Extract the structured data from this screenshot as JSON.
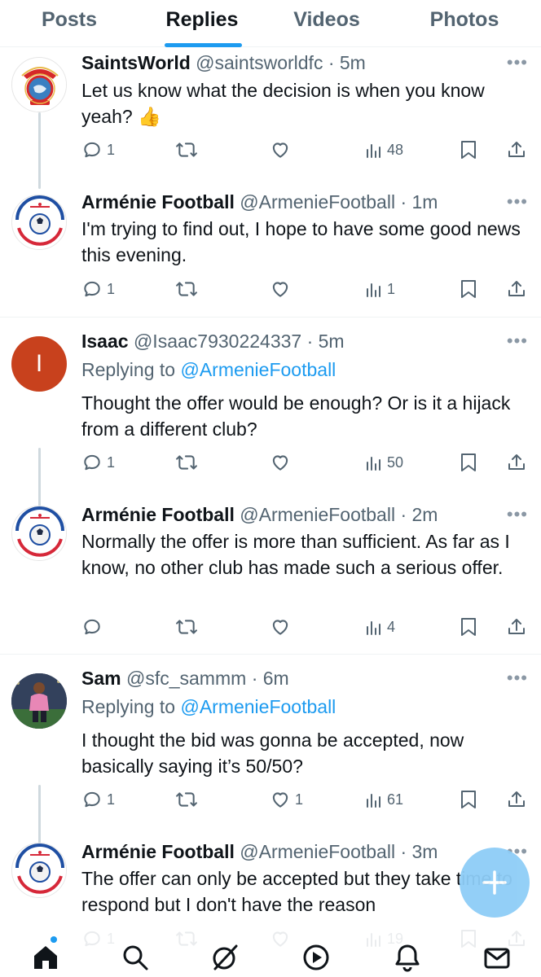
{
  "tabs": [
    {
      "label": "Posts",
      "active": false
    },
    {
      "label": "Replies",
      "active": true
    },
    {
      "label": "Videos",
      "active": false
    },
    {
      "label": "Photos",
      "active": false
    }
  ],
  "tweets": [
    {
      "name": "SaintsWorld",
      "handle": "@saintsworldfc",
      "time": "· 5m",
      "replying_prefix": "",
      "replying_to": "",
      "text": "Let us know what the decision is when you know yeah? 👍",
      "replies": "1",
      "reposts": "",
      "likes": "",
      "views": "48"
    },
    {
      "name": "Arménie Football",
      "handle": "@ArmenieFootball",
      "time": "· 1m",
      "replying_prefix": "",
      "replying_to": "",
      "text": "I'm trying to find out, I hope to have some good news this evening.",
      "replies": "1",
      "reposts": "",
      "likes": "",
      "views": "1"
    },
    {
      "name": "Isaac",
      "handle": "@Isaac7930224337",
      "time": "· 5m",
      "replying_prefix": "Replying to ",
      "replying_to": "@ArmenieFootball",
      "text": "Thought the offer would be enough? Or is it a hijack from a different club?",
      "replies": "1",
      "reposts": "",
      "likes": "",
      "views": "50",
      "avatar_letter": "I"
    },
    {
      "name": "Arménie Football",
      "handle": "@ArmenieFootball",
      "time": "· 2m",
      "replying_prefix": "",
      "replying_to": "",
      "text": "Normally the offer is more than sufficient. As far as I know, no other club has made such a serious offer.",
      "replies": "",
      "reposts": "",
      "likes": "",
      "views": "4"
    },
    {
      "name": "Sam",
      "handle": "@sfc_sammm",
      "time": "· 6m",
      "replying_prefix": "Replying to ",
      "replying_to": "@ArmenieFootball",
      "text": "I thought the bid was gonna be accepted, now basically saying it’s 50/50?",
      "replies": "1",
      "reposts": "",
      "likes": "1",
      "views": "61"
    },
    {
      "name": "Arménie Football",
      "handle": "@ArmenieFootball",
      "time": "· 3m",
      "replying_prefix": "",
      "replying_to": "",
      "text": "The offer can only be accepted but they take time to respond but I don't have the reason",
      "replies": "1",
      "reposts": "",
      "likes": "",
      "views": "19"
    }
  ],
  "colors": {
    "accent": "#1d9bf0",
    "text": "#0f1419",
    "secondary": "#536471",
    "isaac_avatar": "#c8411d"
  },
  "nav_icons": [
    "home-icon",
    "search-icon",
    "grok-icon",
    "spaces-icon",
    "notifications-icon",
    "messages-icon"
  ]
}
